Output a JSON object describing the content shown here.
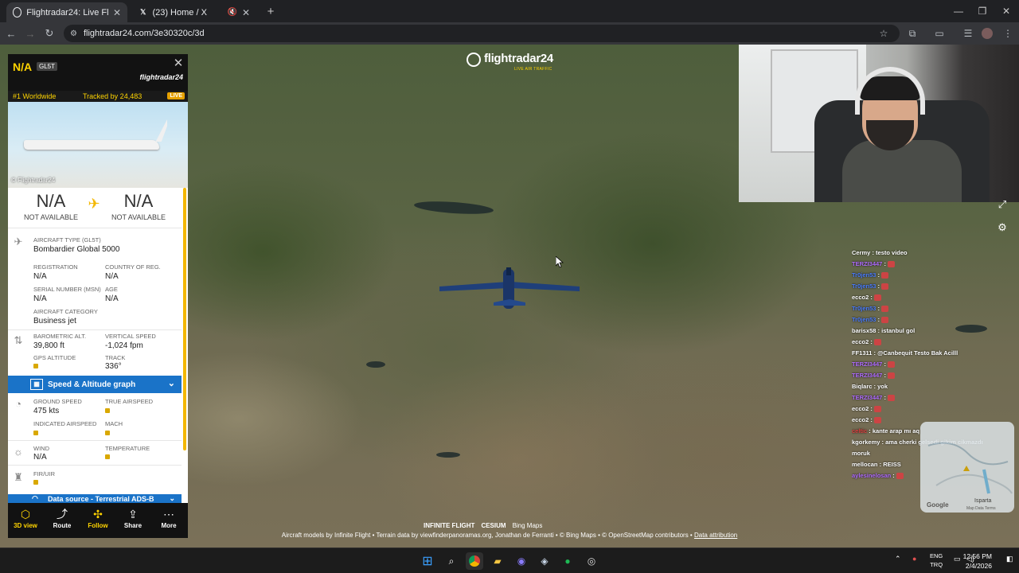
{
  "browser": {
    "tabs": [
      {
        "title": "Flightradar24: Live Flight Tracker",
        "active": true,
        "favicon": "flightradar-icon"
      },
      {
        "title": "(23) Home / X",
        "active": false,
        "favicon": "x-icon"
      }
    ],
    "url": "flightradar24.com/3e30320c/3d"
  },
  "map": {
    "logo_name": "flightradar24",
    "logo_tag": "LIVE AIR TRAFFIC",
    "tech_logos": [
      "INFINITE FLIGHT",
      "CESIUM",
      "Bing Maps"
    ],
    "attribution": "Aircraft models by Infinite Flight • Terrain data by viewfinderpanoramas.org, Jonathan de Ferranti • © Bing Maps • © OpenStreetMap contributors •",
    "attribution_link": "Data attribution",
    "minimap_label": "Isparta",
    "minimap_google": "Google",
    "minimap_data": "Map Data  Terms"
  },
  "chat": [
    {
      "user": "Cermy",
      "text": "testo video",
      "color": "#ffffff"
    },
    {
      "user": "TERZI3447",
      "text": "",
      "color": "#b06cff",
      "emote": true
    },
    {
      "user": "Tr0jen53",
      "text": "",
      "color": "#4a7dff",
      "emote": true
    },
    {
      "user": "Tr0jen53",
      "text": "",
      "color": "#4a7dff",
      "emote": true
    },
    {
      "user": "ecco2",
      "text": "",
      "color": "#ffffff",
      "emote": true
    },
    {
      "user": "Tr0jen53",
      "text": "",
      "color": "#4a7dff",
      "emote": true
    },
    {
      "user": "Tr0jen53",
      "text": "",
      "color": "#4a7dff",
      "emote": true
    },
    {
      "user": "barisx58",
      "text": "istanbul gol",
      "color": "#ffffff"
    },
    {
      "user": "ecco2",
      "text": "",
      "color": "#ffffff",
      "emote": true
    },
    {
      "user": "FF1311",
      "text": "@Canbequit Testo Bak Acilll",
      "color": "#ffffff"
    },
    {
      "user": "TERZI3447",
      "text": "",
      "color": "#b06cff",
      "emote": true
    },
    {
      "user": "TERZI3447",
      "text": "",
      "color": "#b06cff",
      "emote": true
    },
    {
      "user": "Biqlarc",
      "text": "yok",
      "color": "#ffffff"
    },
    {
      "user": "TERZI3447",
      "text": "",
      "color": "#b06cff",
      "emote": true
    },
    {
      "user": "ecco2",
      "text": "",
      "color": "#ffffff",
      "emote": true
    },
    {
      "user": "ecco2",
      "text": "",
      "color": "#ffffff",
      "emote": true
    },
    {
      "user": "celtic",
      "text": "kante arap mı aq",
      "color": "#e04040"
    },
    {
      "user": "kgorkemy",
      "text": "ama cherki gelsedi gikim cikmazdı",
      "color": "#ffffff"
    },
    {
      "user": "",
      "text": "moruk",
      "color": "#ffffff"
    },
    {
      "user": "mellocan",
      "text": "REISS",
      "color": "#ffffff"
    },
    {
      "user": "aylesinelosan",
      "text": "",
      "color": "#b06cff",
      "emote": true
    }
  ],
  "panel": {
    "callsign": "N/A",
    "type_badge": "GL5T",
    "brand": "flightradar24",
    "rank": "#1 Worldwide",
    "tracked": "Tracked by 24,483",
    "live": "LIVE",
    "photo_credit": "© Flightradar24",
    "origin_code": "N/A",
    "origin_name": "NOT AVAILABLE",
    "dest_code": "N/A",
    "dest_name": "NOT AVAILABLE",
    "aircraft_type_label": "AIRCRAFT TYPE (GL5T)",
    "aircraft_type": "Bombardier Global 5000",
    "registration_label": "REGISTRATION",
    "registration": "N/A",
    "country_label": "COUNTRY OF REG.",
    "country": "N/A",
    "serial_label": "SERIAL NUMBER (MSN)",
    "serial": "N/A",
    "age_label": "AGE",
    "age": "N/A",
    "category_label": "AIRCRAFT CATEGORY",
    "category": "Business jet",
    "baro_label": "BAROMETRIC ALT.",
    "baro": "39,800 ft",
    "vspeed_label": "VERTICAL SPEED",
    "vspeed": "-1,024 fpm",
    "gps_label": "GPS ALTITUDE",
    "track_label": "TRACK",
    "track": "336°",
    "speed_graph": "Speed & Altitude graph",
    "ground_speed_label": "GROUND SPEED",
    "ground_speed": "475 kts",
    "tas_label": "TRUE AIRSPEED",
    "ias_label": "INDICATED AIRSPEED",
    "mach_label": "MACH",
    "wind_label": "WIND",
    "wind": "N/A",
    "temp_label": "TEMPERATURE",
    "fir_label": "FIR/UIR",
    "data_source": "Data source - Terrestrial ADS-B",
    "nav": [
      {
        "label": "3D view",
        "icon": "cube-icon"
      },
      {
        "label": "Route",
        "icon": "route-icon"
      },
      {
        "label": "Follow",
        "icon": "follow-icon"
      },
      {
        "label": "Share",
        "icon": "share-icon"
      },
      {
        "label": "More",
        "icon": "more-icon"
      }
    ]
  },
  "taskbar": {
    "lang_top": "ENG",
    "lang_bottom": "TRQ",
    "time": "12:56 PM",
    "date": "2/4/2026"
  }
}
